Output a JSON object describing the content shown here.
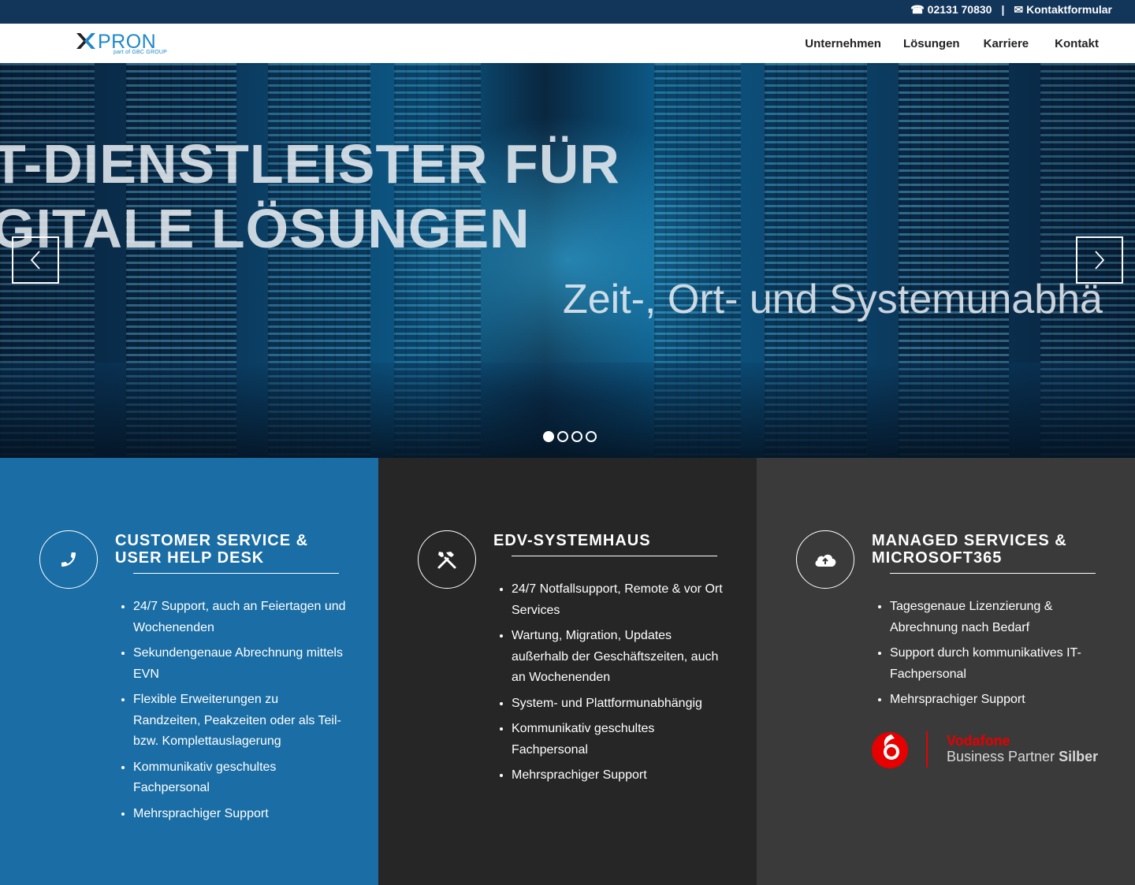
{
  "topbar": {
    "phone_icon": "☎",
    "phone": "02131 70830",
    "separator": "|",
    "mail_icon": "✉",
    "contact_form": "Kontaktformular"
  },
  "header": {
    "logo_text": "PRON",
    "logo_sub": "part of GBC GROUP",
    "nav": [
      "Unternehmen",
      "Lösungen",
      "Karriere",
      "Kontakt"
    ]
  },
  "hero": {
    "line1": "T-DIENSTLEISTER FÜR",
    "line2": "GITALE LÖSUNGEN",
    "subtitle": "Zeit-, Ort- und Systemunabhä",
    "slides_total": 4,
    "active_slide": 1
  },
  "columns": [
    {
      "icon": "phone-icon",
      "title": "CUSTOMER SERVICE & USER HELP DESK",
      "items": [
        "24/7 Support, auch an Feiertagen und Wochenenden",
        "Sekundengenaue Abrechnung mittels EVN",
        "Flexible Erweiterungen zu Randzeiten, Peakzeiten oder als Teil- bzw. Komplettauslagerung",
        "Kommunikativ geschultes Fachpersonal",
        "Mehrsprachiger Support"
      ]
    },
    {
      "icon": "tools-icon",
      "title": "EDV-SYSTEMHAUS",
      "items": [
        "24/7 Notfallsupport, Remote & vor Ort Services",
        "Wartung, Migration, Updates außerhalb der Geschäftszeiten, auch an Wochenenden",
        "System- und Plattformunabhängig",
        "Kommunikativ geschultes Fachpersonal",
        "Mehrsprachiger Support"
      ]
    },
    {
      "icon": "cloud-upload-icon",
      "title": "MANAGED SERVICES & MICROSOFT365",
      "items": [
        "Tagesgenaue Lizenzierung & Abrechnung nach Bedarf",
        "Support durch kommunikatives IT-Fachpersonal",
        "Mehrsprachiger Support"
      ],
      "partner_line1": "Vodafone",
      "partner_line2": "Business Partner",
      "partner_line3": "Silber"
    }
  ],
  "colors": {
    "topbar": "#12355a",
    "col1": "#1a6ea5",
    "col2": "#262626",
    "col3": "#3a3a3a",
    "logo": "#1e88c8",
    "vodafone_red": "#e60000"
  }
}
